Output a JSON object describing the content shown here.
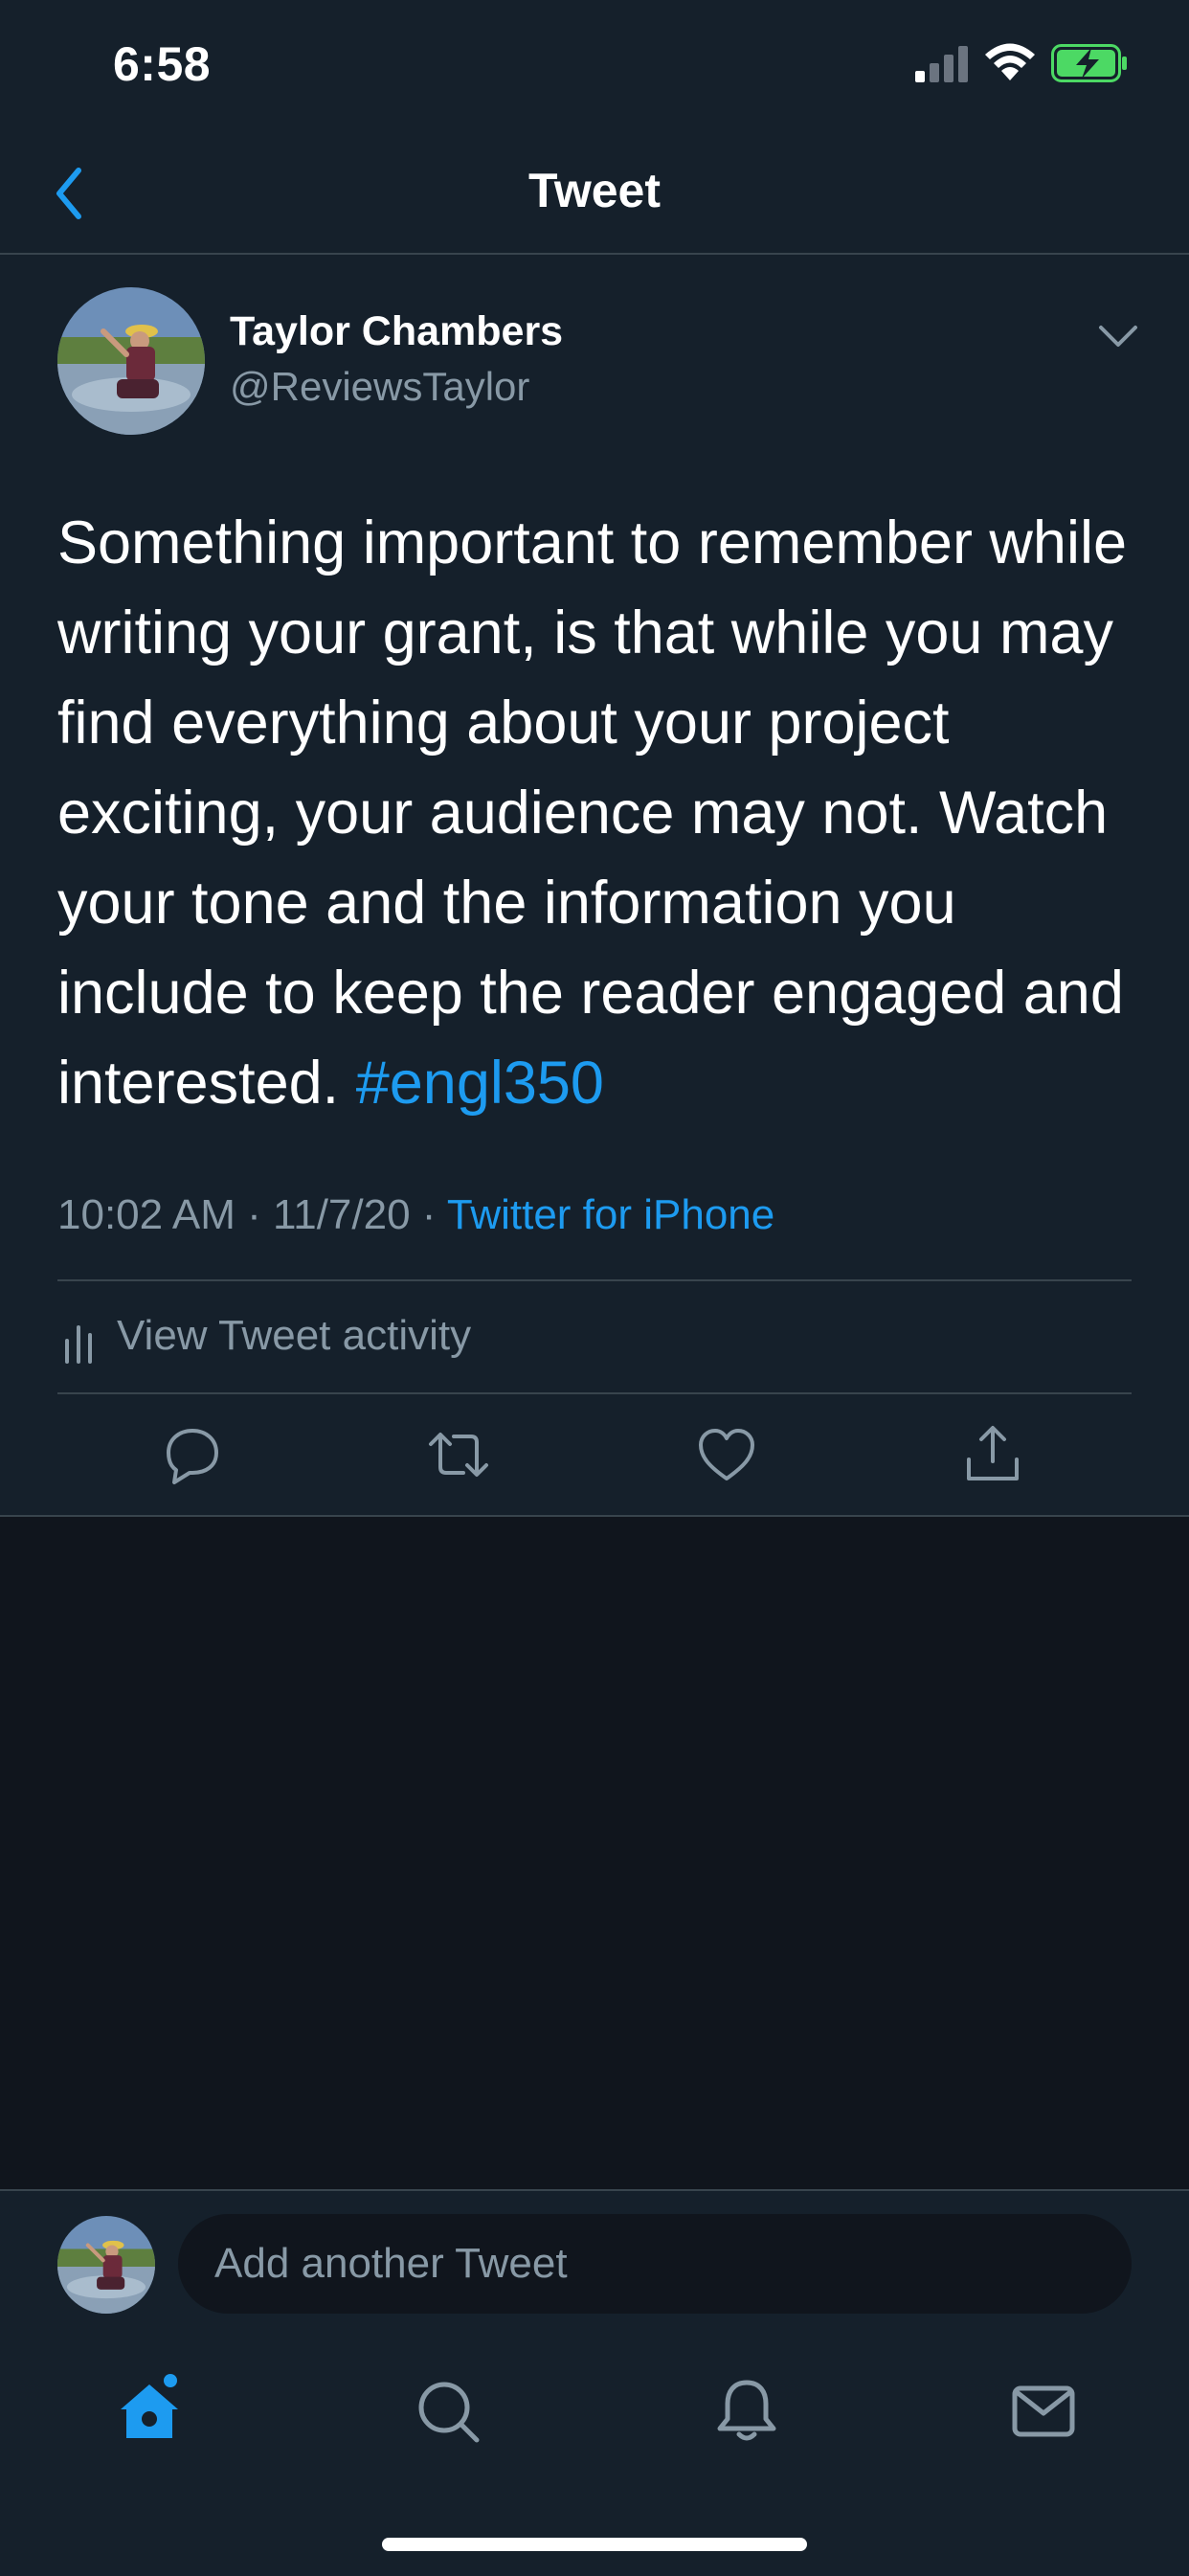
{
  "status_bar": {
    "time": "6:58"
  },
  "nav": {
    "title": "Tweet"
  },
  "tweet": {
    "author_name": "Taylor Chambers",
    "author_handle": "@ReviewsTaylor",
    "text": "Something important to remember while writing your grant, is that while you may find everything about your project exciting, your audience may not. Watch your tone and the information you include to keep the reader engaged and interested.",
    "hashtag": "#engl350",
    "time": "10:02 AM",
    "separator": " · ",
    "date": "11/7/20",
    "source": "Twitter for iPhone"
  },
  "activity": {
    "label": "View Tweet activity"
  },
  "actions": [
    "reply-icon",
    "retweet-icon",
    "like-icon",
    "share-icon"
  ],
  "compose": {
    "placeholder": "Add another Tweet"
  },
  "tabs": [
    "home-icon",
    "search-icon",
    "notifications-icon",
    "messages-icon"
  ],
  "colors": {
    "background": "#15202b",
    "accent": "#1d9bf0",
    "secondary_text": "#8899a6",
    "divider": "#38444d",
    "battery": "#4cd964"
  }
}
